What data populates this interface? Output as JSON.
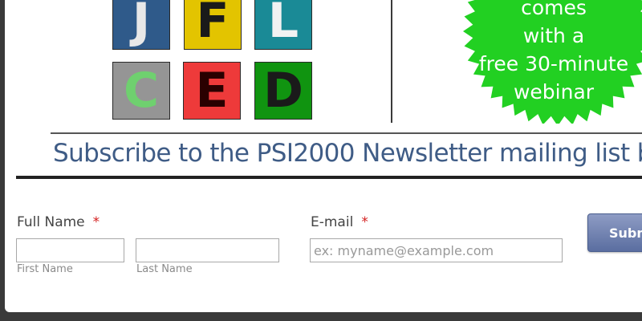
{
  "banner": {
    "tiles": [
      "J",
      "F",
      "L",
      "C",
      "E",
      "D"
    ],
    "badge_lines": [
      "comes",
      "with a",
      "free 30-minute",
      "webinar"
    ],
    "newsletter_text": "Subscribe to the PSI2000 Newsletter mailing list b"
  },
  "form": {
    "full_name_label": "Full Name",
    "required_mark": "*",
    "first_name_value": "",
    "first_name_sublabel": "First Name",
    "last_name_value": "",
    "last_name_sublabel": "Last Name",
    "email_label": "E-mail",
    "email_value": "",
    "email_placeholder": "ex: myname@example.com",
    "submit_label": "Submit"
  },
  "colors": {
    "overlay": "#3a3a3a",
    "badge_green": "#22d022",
    "newsletter_blue": "#3f5c86",
    "required_red": "#d42020",
    "submit_blue": "#5a6ea0"
  }
}
